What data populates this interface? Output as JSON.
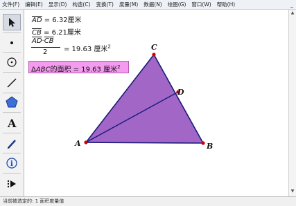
{
  "menu": {
    "items": [
      "文件(F)",
      "编辑(E)",
      "显示(D)",
      "构造(C)",
      "变换(T)",
      "度量(M)",
      "数据(N)",
      "绘图(G)",
      "窗口(W)",
      "帮助(H)"
    ],
    "minimize": "_"
  },
  "measurements": {
    "ad": {
      "segment": "AD",
      "value": "= 6.32厘米"
    },
    "cb": {
      "segment": "CB",
      "value": "= 6.21厘米"
    },
    "formula": {
      "num_a": "AD",
      "dot": "·",
      "num_b": "CB",
      "den": "2",
      "value": "= 19.63 厘米",
      "exp": "2"
    },
    "area": {
      "delta": "Δ",
      "tri": "ABC",
      "text": "的面积 = 19.63 厘米",
      "exp": "2"
    }
  },
  "points": {
    "A": "A",
    "B": "B",
    "C": "C",
    "D": "D"
  },
  "status": {
    "text": "当前被选定的: 1 面积度量值"
  },
  "colors": {
    "triangle_fill": "#a267c6",
    "triangle_stroke": "#1a1a7a",
    "point": "#cc0000",
    "area_box": "#f49bf0"
  }
}
